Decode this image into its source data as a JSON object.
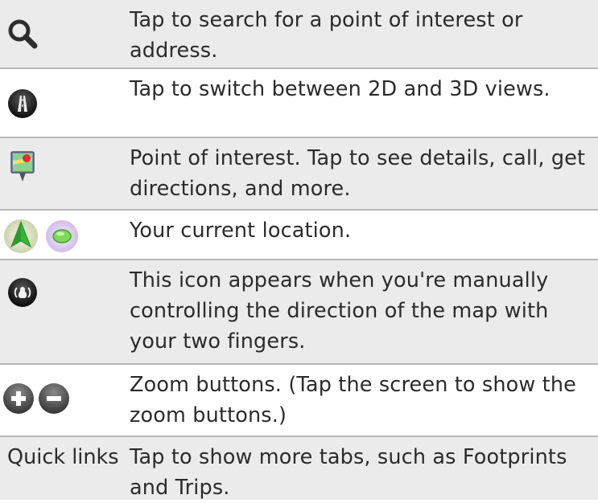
{
  "rows": [
    {
      "icon": "search-icon",
      "text": "Tap to search for a point of interest or address."
    },
    {
      "icon": "2d-3d-view-icon",
      "text": "Tap to switch between 2D and 3D views."
    },
    {
      "icon": "point-of-interest-icon",
      "text": "Point of interest. Tap to see details, call, get directions, and more."
    },
    {
      "icon": "current-location-icon",
      "text": "Your current location."
    },
    {
      "icon": "manual-direction-icon",
      "text": "This icon appears when you're manually controlling the direction of the map with your two fingers."
    },
    {
      "icon": "zoom-buttons-icon",
      "text": "Zoom buttons. (Tap the screen to show the zoom buttons.)"
    },
    {
      "label": "Quick links",
      "text": "Tap to show more tabs, such as Footprints and Trips."
    }
  ],
  "colors": {
    "row_shade": "#ebebeb",
    "divider": "#b8b8b8",
    "text": "#2b2b2b",
    "location_arrow": "#3cb43c",
    "location_dot": "#7ed957"
  }
}
